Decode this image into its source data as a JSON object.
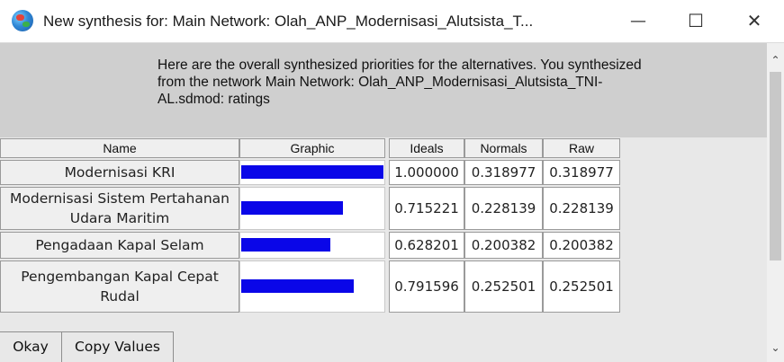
{
  "window": {
    "title": "New synthesis for: Main Network: Olah_ANP_Modernisasi_Alutsista_T...",
    "minimize_glyph": "—",
    "maximize_glyph": "☐",
    "close_glyph": "✕"
  },
  "message": "Here are the overall synthesized priorities for the alternatives.  You synthesized from the network Main Network: Olah_ANP_Modernisasi_Alutsista_TNI-AL.sdmod: ratings",
  "table": {
    "headers": {
      "name": "Name",
      "graphic": "Graphic",
      "ideals": "Ideals",
      "normals": "Normals",
      "raw": "Raw"
    },
    "bar_color": "#0a06e8",
    "rows": [
      {
        "name": "Modernisasi KRI",
        "ideal_value": 1.0,
        "ideals": "1.000000",
        "normals": "0.318977",
        "raw": "0.318977"
      },
      {
        "name": "Modernisasi Sistem Pertahanan Udara Maritim",
        "ideal_value": 0.715221,
        "ideals": "0.715221",
        "normals": "0.228139",
        "raw": "0.228139"
      },
      {
        "name": "Pengadaan Kapal Selam",
        "ideal_value": 0.628201,
        "ideals": "0.628201",
        "normals": "0.200382",
        "raw": "0.200382"
      },
      {
        "name": "Pengembangan Kapal Cepat Rudal",
        "ideal_value": 0.791596,
        "ideals": "0.791596",
        "normals": "0.252501",
        "raw": "0.252501"
      }
    ]
  },
  "buttons": {
    "okay": "Okay",
    "copy_values": "Copy Values"
  },
  "scrollbar": {
    "up_glyph": "⌃",
    "down_glyph": "⌄"
  }
}
